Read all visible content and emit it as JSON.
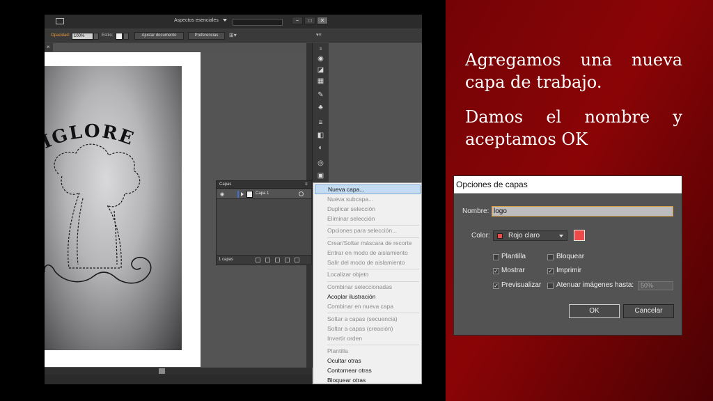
{
  "workspace": {
    "menu_label": "Aspectos esenciales"
  },
  "window_buttons": [
    "−",
    "□",
    "✕"
  ],
  "control_bar": {
    "opacity_label": "Opacidad:",
    "opacity_value": "100%",
    "style_label": "Estilo:",
    "adjust_button": "Ajustar documento",
    "prefs_button": "Preferencias"
  },
  "layers_panel": {
    "tab_label": "Capas",
    "menu_glyph": "▸▸ ≡",
    "layer_name": "Capa 1",
    "count_label": "1 capas"
  },
  "context_menu": {
    "items": [
      {
        "label": "Nueva capa...",
        "enabled": true,
        "highlighted": true
      },
      {
        "label": "Nueva subcapa...",
        "enabled": false
      },
      {
        "label": "Duplicar selección",
        "enabled": false
      },
      {
        "label": "Eliminar selección",
        "enabled": false
      },
      {
        "label": "Opciones para selección...",
        "enabled": false
      },
      {
        "label": "Crear/Soltar máscara de recorte",
        "enabled": false
      },
      {
        "label": "Entrar en modo de aislamiento",
        "enabled": false
      },
      {
        "label": "Salir del modo de aislamiento",
        "enabled": false
      },
      {
        "label": "Localizar objeto",
        "enabled": false
      },
      {
        "label": "Combinar seleccionadas",
        "enabled": false
      },
      {
        "label": "Acoplar ilustración",
        "enabled": true
      },
      {
        "label": "Combinar en nueva capa",
        "enabled": false
      },
      {
        "label": "Soltar a capas (secuencia)",
        "enabled": false
      },
      {
        "label": "Soltar a capas (creación)",
        "enabled": false
      },
      {
        "label": "Invertir orden",
        "enabled": false
      },
      {
        "label": "Plantilla",
        "enabled": false
      },
      {
        "label": "Ocultar otras",
        "enabled": true
      },
      {
        "label": "Contornear otras",
        "enabled": true
      },
      {
        "label": "Bloquear otras",
        "enabled": true
      }
    ]
  },
  "artwork": {
    "logo_text": "RIGLORE"
  },
  "slide": {
    "line1": "Agregamos una nueva capa de trabajo.",
    "line2": "Damos el nombre y aceptamos OK"
  },
  "dialog": {
    "title": "Opciones de capas",
    "name_label": "Nombre:",
    "name_value": "logo",
    "color_label": "Color:",
    "color_value": "Rojo claro",
    "layer_color": "#ee4a4a",
    "options": {
      "template": {
        "label": "Plantilla",
        "checked": false
      },
      "lock": {
        "label": "Bloquear",
        "checked": false
      },
      "show": {
        "label": "Mostrar",
        "checked": true
      },
      "print": {
        "label": "Imprimir",
        "checked": true
      },
      "preview": {
        "label": "Previsualizar",
        "checked": true
      },
      "dim": {
        "label": "Atenuar imágenes hasta:",
        "checked": false
      }
    },
    "dim_value": "50%",
    "ok_label": "OK",
    "cancel_label": "Cancelar"
  },
  "colors": {
    "slide_red": "#8a0406",
    "menu_highlight": "#c4dcf2",
    "layer_color_bar": "#3d6fd8",
    "focus_border": "#d79b42"
  }
}
